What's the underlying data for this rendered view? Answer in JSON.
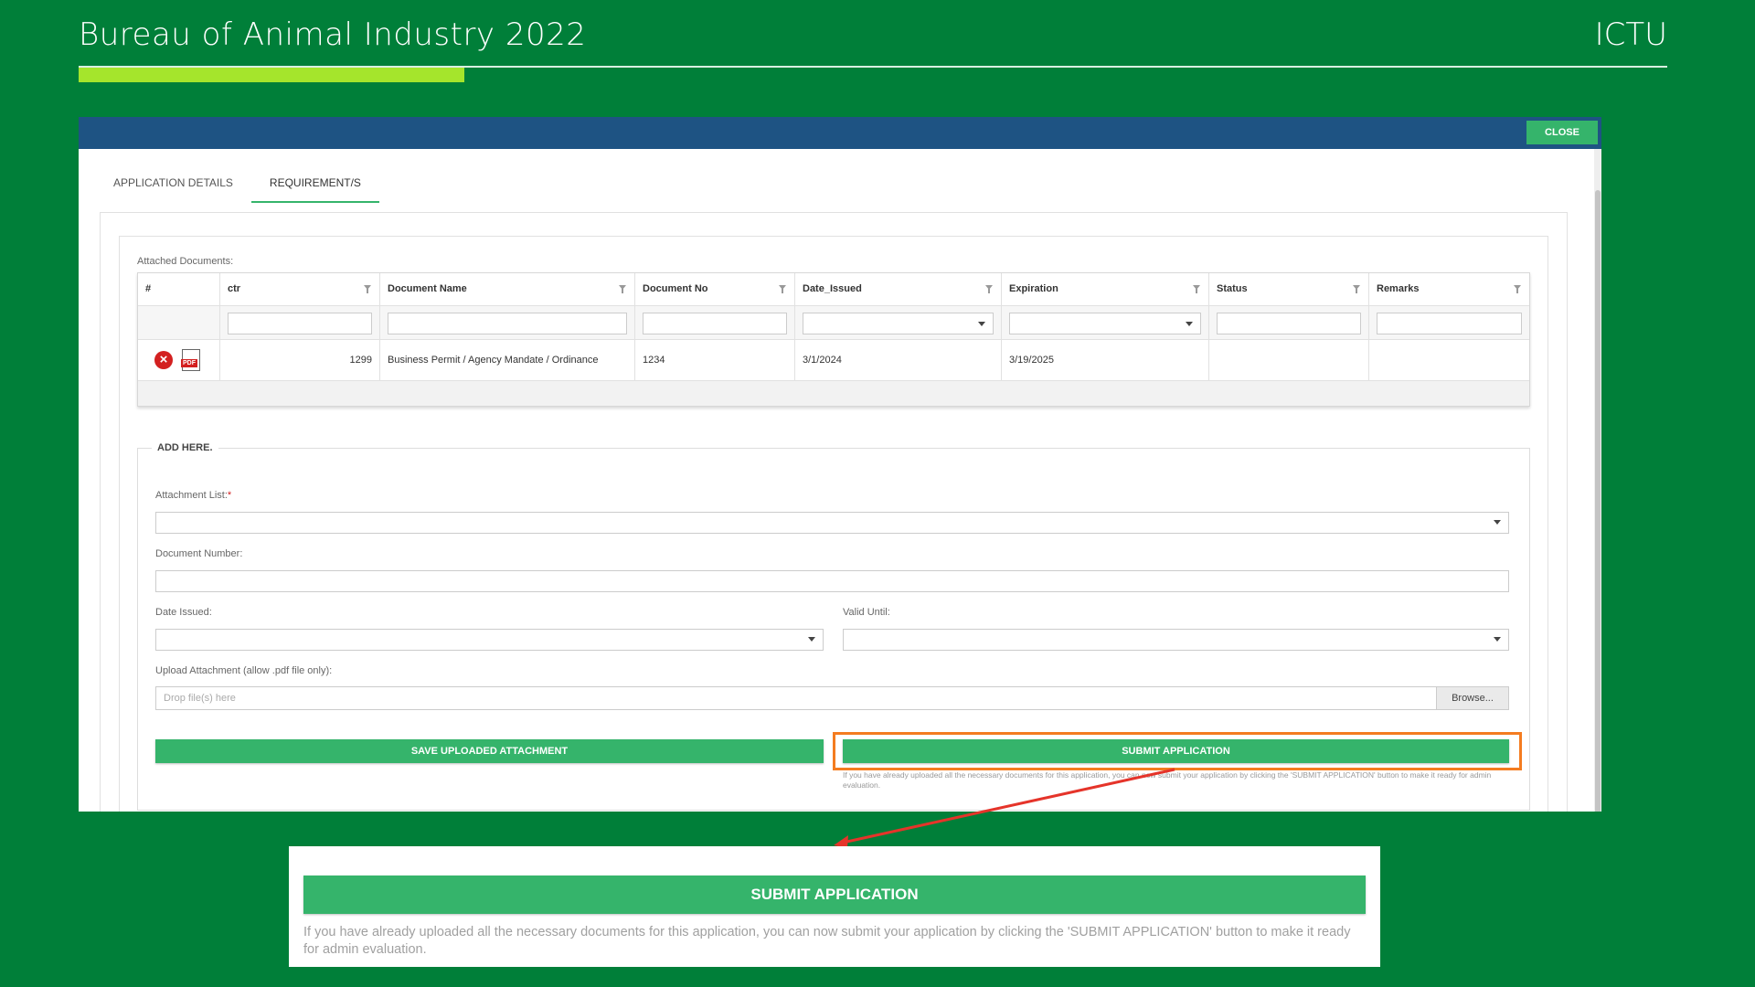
{
  "slide": {
    "title": "Bureau of Animal Industry 2022",
    "right_label": "ICTU",
    "accent_color": "#a5e52c",
    "background_color": "#007f39"
  },
  "window": {
    "close_label": "CLOSE",
    "header_color": "#1e5383"
  },
  "tabs": [
    {
      "label": "APPLICATION DETAILS",
      "active": false
    },
    {
      "label": "REQUIREMENT/S",
      "active": true
    }
  ],
  "attached": {
    "label": "Attached Documents:",
    "columns": [
      "#",
      "ctr",
      "Document Name",
      "Document No",
      "Date_Issued",
      "Expiration",
      "Status",
      "Remarks"
    ],
    "rows": [
      {
        "ctr": "1299",
        "document_name": "Business Permit / Agency Mandate / Ordinance",
        "document_no": "1234",
        "date_issued": "3/1/2024",
        "expiration": "3/19/2025",
        "status": "",
        "remarks": "",
        "icons": [
          "delete-icon",
          "pdf-icon"
        ]
      }
    ]
  },
  "form": {
    "legend": "ADD HERE.",
    "attachment_list_label": "Attachment List:",
    "required_mark": "*",
    "document_number_label": "Document Number:",
    "date_issued_label": "Date Issued:",
    "valid_until_label": "Valid Until:",
    "upload_label": "Upload Attachment (allow .pdf file only):",
    "dropzone_placeholder": "Drop file(s) here",
    "browse_label": "Browse...",
    "save_label": "SAVE UPLOADED ATTACHMENT",
    "submit_label": "SUBMIT APPLICATION",
    "hint": "If you have already uploaded all the necessary documents for this application, you can now submit your application by clicking the 'SUBMIT APPLICATION' button to make it ready for admin evaluation."
  },
  "zoom": {
    "submit_label": "SUBMIT APPLICATION",
    "hint": "If you have already uploaded all the necessary documents for this application, you can now submit your application by clicking the 'SUBMIT APPLICATION' button to make it ready for admin evaluation."
  },
  "colors": {
    "button_green": "#35b46b",
    "highlight": "#f47c20",
    "arrow": "#e5342a"
  }
}
